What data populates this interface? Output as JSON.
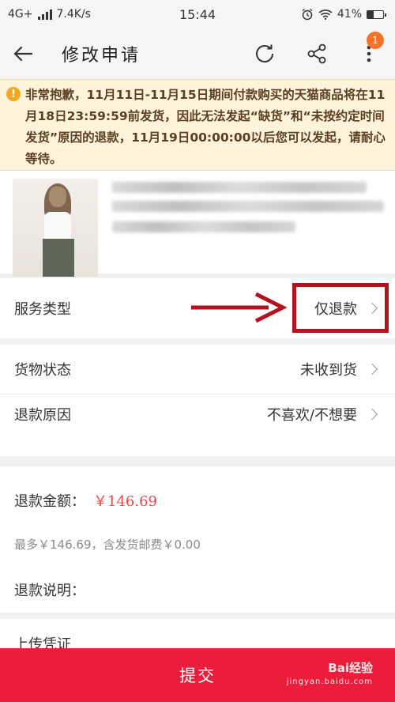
{
  "status_bar": {
    "network": "4G+",
    "speed": "7.4K/s",
    "time": "15:44",
    "battery": "41%"
  },
  "nav": {
    "title": "修改申请",
    "badge_count": "1"
  },
  "notice": {
    "text": "非常抱歉，11月11日-11月15日期间付款购买的天猫商品将在11月18日23:59:59前发货，因此无法发起“缺货”和“未按约定时间发货”原因的退款，11月19日00:00:00以后您可以发起，请耐心等待。"
  },
  "form": {
    "service_type": {
      "label": "服务类型",
      "value": "仅退款"
    },
    "goods_status": {
      "label": "货物状态",
      "value": "未收到货"
    },
    "refund_reason": {
      "label": "退款原因",
      "value": "不喜欢/不想要"
    },
    "refund_amount": {
      "label": "退款金额：",
      "value": "￥146.69"
    },
    "amount_hint": "最多￥146.69，含发货邮费￥0.00",
    "refund_description": {
      "label": "退款说明："
    },
    "upload": {
      "label": "上传凭证"
    }
  },
  "submit": {
    "label": "提交"
  },
  "watermark": {
    "brand": "Bai经验",
    "url": "jingyan.baidu.com"
  },
  "colors": {
    "accent_red": "#ec1d3a",
    "amount_red": "#e5484d",
    "highlight_red": "#b3121f",
    "notice_bg": "#fff3dc",
    "badge_orange": "#f5732b"
  }
}
